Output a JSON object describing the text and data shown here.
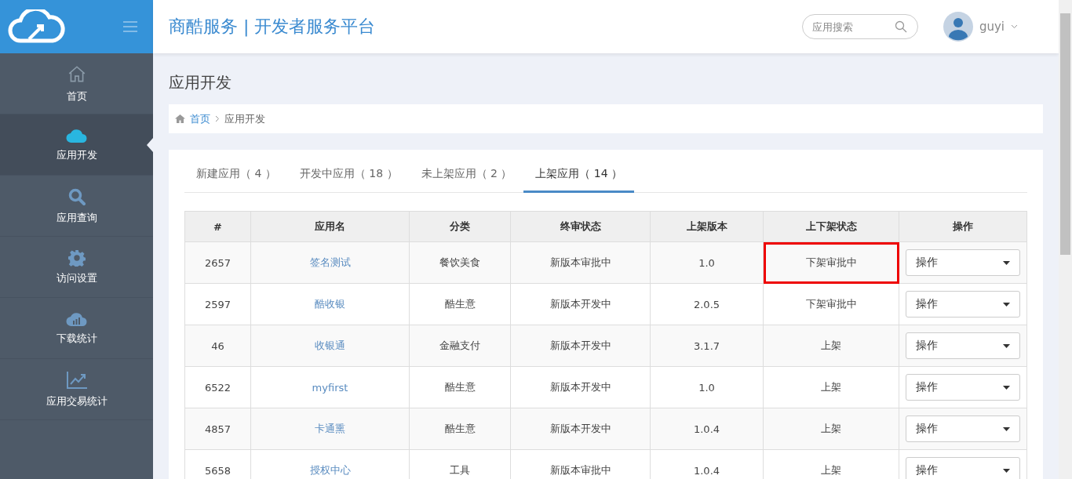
{
  "header": {
    "title": "商酷服务 | 开发者服务平台",
    "search": {
      "placeholder": "应用搜索"
    },
    "user": {
      "name": "guyi"
    }
  },
  "sidebar": {
    "items": [
      {
        "label": "首页",
        "selected": false
      },
      {
        "label": "应用开发",
        "selected": true
      },
      {
        "label": "应用查询",
        "selected": false
      },
      {
        "label": "访问设置",
        "selected": false
      },
      {
        "label": "下载统计",
        "selected": false
      },
      {
        "label": "应用交易统计",
        "selected": false
      }
    ]
  },
  "page_title": "应用开发",
  "breadcrumb": [
    {
      "label": "首页",
      "link": true
    },
    {
      "label": "应用开发",
      "link": false
    }
  ],
  "tabs": [
    {
      "label": "新建应用（ 4 ）",
      "selected": false
    },
    {
      "label": "开发中应用（ 18 ）",
      "selected": false
    },
    {
      "label": "未上架应用（ 2 ）",
      "selected": false
    },
    {
      "label": "上架应用（ 14 ）",
      "selected": true
    }
  ],
  "table": {
    "columns": [
      "#",
      "应用名",
      "分类",
      "终审状态",
      "上架版本",
      "上下架状态",
      "操作"
    ],
    "rows": [
      {
        "id": "2657",
        "name": "签名测试",
        "category": "餐饮美食",
        "review": "新版本审批中",
        "version": "1.0",
        "shelf": "下架审批中",
        "action": "操作",
        "highlighted": true
      },
      {
        "id": "2597",
        "name": "酷收银",
        "category": "酷生意",
        "review": "新版本开发中",
        "version": "2.0.5",
        "shelf": "下架审批中",
        "action": "操作",
        "highlighted": false
      },
      {
        "id": "46",
        "name": "收银通",
        "category": "金融支付",
        "review": "新版本开发中",
        "version": "3.1.7",
        "shelf": "上架",
        "action": "操作",
        "highlighted": false
      },
      {
        "id": "6522",
        "name": "myfirst",
        "category": "酷生意",
        "review": "新版本开发中",
        "version": "1.0",
        "shelf": "上架",
        "action": "操作",
        "highlighted": false
      },
      {
        "id": "4857",
        "name": "卡通熏",
        "category": "酷生意",
        "review": "新版本开发中",
        "version": "1.0.4",
        "shelf": "上架",
        "action": "操作",
        "highlighted": false
      },
      {
        "id": "5658",
        "name": "授权中心",
        "category": "工具",
        "review": "新版本审批中",
        "version": "1.0.4",
        "shelf": "上架",
        "action": "操作",
        "highlighted": false
      }
    ]
  }
}
